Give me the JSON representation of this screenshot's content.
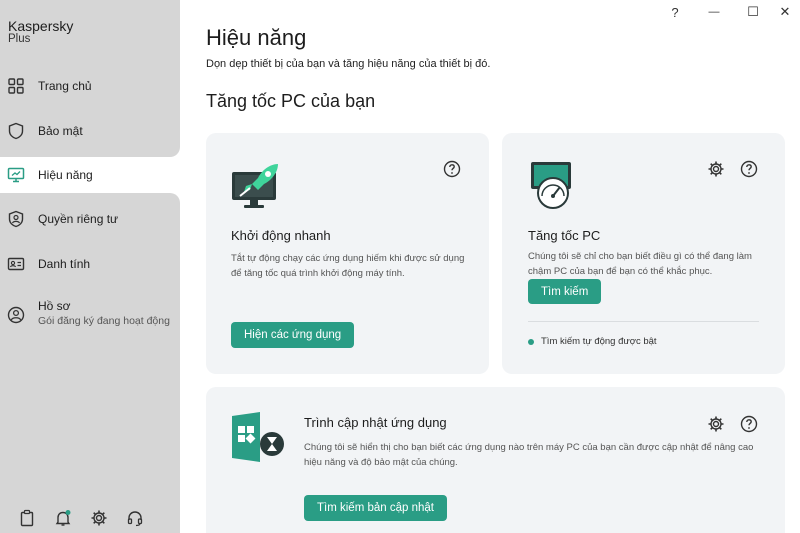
{
  "sidebar": {
    "brand": "Kaspersky",
    "brand_sub": "Plus",
    "items": [
      {
        "label": "Trang chủ",
        "icon": "dashboard-icon"
      },
      {
        "label": "Bảo mật",
        "icon": "shield-icon"
      },
      {
        "label": "Hiệu năng",
        "icon": "monitor-icon",
        "active": true
      },
      {
        "label": "Quyền riêng tư",
        "icon": "privacy-shield-icon"
      },
      {
        "label": "Danh tính",
        "icon": "id-card-icon"
      },
      {
        "label": "Hồ sơ",
        "sublabel": "Gói đăng ký đang hoạt động",
        "icon": "profile-icon"
      }
    ],
    "footer": [
      "clipboard-icon",
      "bell-icon",
      "gear-icon",
      "headset-icon"
    ]
  },
  "window": {
    "help": "?",
    "minimize": "—",
    "maximize": "☐",
    "close": "✕"
  },
  "main": {
    "title": "Hiệu năng",
    "subtitle": "Dọn dẹp thiết bị của bạn và tăng hiệu năng của thiết bị đó.",
    "section_title": "Tăng tốc PC của bạn"
  },
  "cards": {
    "startup": {
      "title": "Khởi động nhanh",
      "desc": "Tắt tự động chạy các ứng dụng hiếm khi được sử dụng để tăng tốc quá trình khởi động máy tính.",
      "button": "Hiện các ứng dụng"
    },
    "speedup": {
      "title": "Tăng tốc PC",
      "desc": "Chúng tôi sẽ chỉ cho bạn biết điều gì có thể đang làm chậm PC của bạn để bạn có thể khắc phục.",
      "button": "Tìm kiếm",
      "status": "Tìm kiếm tự động được bật"
    },
    "updater": {
      "title": "Trình cập nhật ứng dụng",
      "desc": "Chúng tôi sẽ hiển thị cho bạn biết các ứng dụng nào trên máy PC của bạn cần được cập nhật để nâng cao hiệu năng và độ bảo mật của chúng.",
      "button": "Tìm kiếm bản cập nhật"
    }
  },
  "colors": {
    "accent": "#2a9d85",
    "sidebar": "#d6d6d6",
    "card": "#f2f4f6"
  }
}
